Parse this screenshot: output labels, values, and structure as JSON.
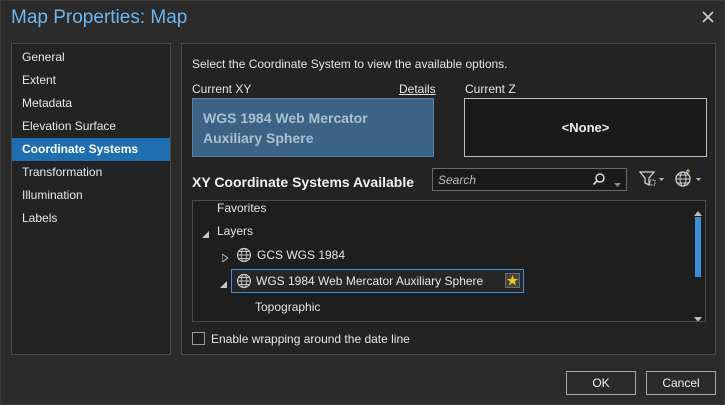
{
  "window": {
    "title": "Map Properties: Map"
  },
  "sidebar": {
    "items": [
      {
        "label": "General"
      },
      {
        "label": "Extent"
      },
      {
        "label": "Metadata"
      },
      {
        "label": "Elevation Surface"
      },
      {
        "label": "Coordinate Systems",
        "active": true
      },
      {
        "label": "Transformation"
      },
      {
        "label": "Illumination"
      },
      {
        "label": "Labels"
      }
    ]
  },
  "main": {
    "instruction": "Select the Coordinate System to view the available options.",
    "current_xy_label": "Current XY",
    "details_link": "Details",
    "current_xy_value": "WGS 1984 Web Mercator Auxiliary Sphere",
    "current_z_label": "Current Z",
    "current_z_value": "<None>",
    "available_heading": "XY Coordinate Systems Available",
    "search": {
      "placeholder": "Search",
      "value": ""
    },
    "tree": {
      "favorites": "Favorites",
      "layers": "Layers",
      "gcs_item": "GCS WGS 1984",
      "selected_item": "WGS 1984 Web Mercator Auxiliary Sphere",
      "child_item": "Topographic"
    },
    "wrap_label": "Enable wrapping around the date line",
    "wrap_checked": false
  },
  "buttons": {
    "ok": "OK",
    "cancel": "Cancel"
  },
  "colors": {
    "accent": "#1f6fb0",
    "title": "#6fb6ee",
    "background": "#2b2b2b",
    "selection_border": "#3e8fd6"
  }
}
